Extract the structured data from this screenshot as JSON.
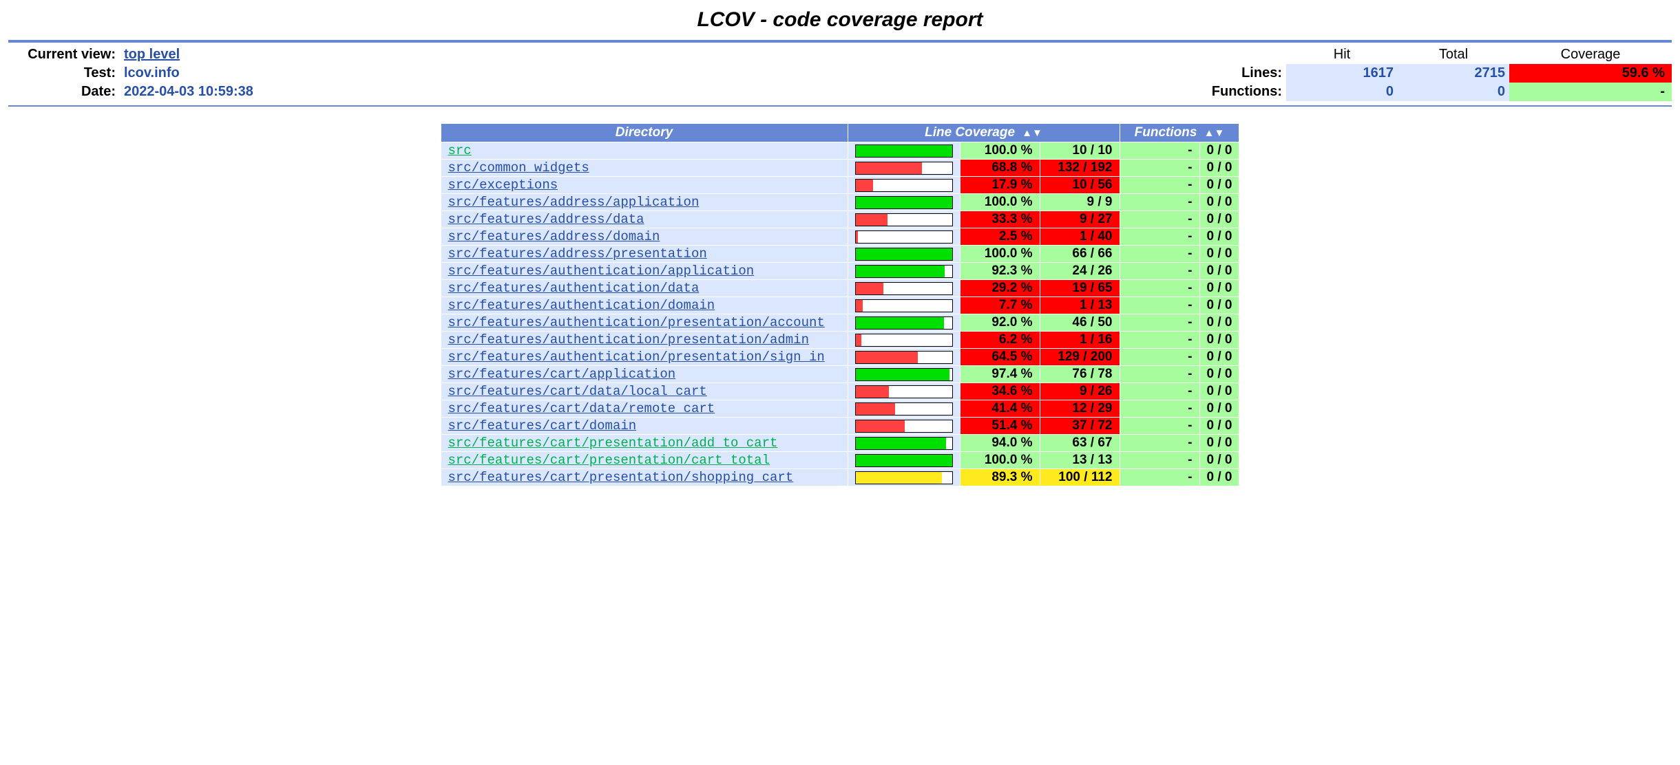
{
  "title": "LCOV - code coverage report",
  "summary": {
    "labels": {
      "current_view": "Current view:",
      "test": "Test:",
      "date": "Date:",
      "lines": "Lines:",
      "functions": "Functions:",
      "hit": "Hit",
      "total": "Total",
      "coverage": "Coverage"
    },
    "current_view": "top level",
    "test": "lcov.info",
    "date": "2022-04-03 10:59:38",
    "lines": {
      "hit": "1617",
      "total": "2715",
      "cov": "59.6 %",
      "level": "lo"
    },
    "functions": {
      "hit": "0",
      "total": "0",
      "cov": "-",
      "level": "hi"
    }
  },
  "table": {
    "headers": {
      "directory": "Directory",
      "line_coverage": "Line Coverage",
      "functions": "Functions",
      "sort_glyph": "◆"
    },
    "rows": [
      {
        "name": "src",
        "link": "green",
        "pct": 100.0,
        "pct_s": "100.0 %",
        "cnt": "10 / 10",
        "fpct": "-",
        "fcnt": "0 / 0"
      },
      {
        "name": "src/common_widgets",
        "link": "blue",
        "pct": 68.8,
        "pct_s": "68.8 %",
        "cnt": "132 / 192",
        "fpct": "-",
        "fcnt": "0 / 0"
      },
      {
        "name": "src/exceptions",
        "link": "blue",
        "pct": 17.9,
        "pct_s": "17.9 %",
        "cnt": "10 / 56",
        "fpct": "-",
        "fcnt": "0 / 0"
      },
      {
        "name": "src/features/address/application",
        "link": "blue",
        "pct": 100.0,
        "pct_s": "100.0 %",
        "cnt": "9 / 9",
        "fpct": "-",
        "fcnt": "0 / 0"
      },
      {
        "name": "src/features/address/data",
        "link": "blue",
        "pct": 33.3,
        "pct_s": "33.3 %",
        "cnt": "9 / 27",
        "fpct": "-",
        "fcnt": "0 / 0"
      },
      {
        "name": "src/features/address/domain",
        "link": "blue",
        "pct": 2.5,
        "pct_s": "2.5 %",
        "cnt": "1 / 40",
        "fpct": "-",
        "fcnt": "0 / 0"
      },
      {
        "name": "src/features/address/presentation",
        "link": "blue",
        "pct": 100.0,
        "pct_s": "100.0 %",
        "cnt": "66 / 66",
        "fpct": "-",
        "fcnt": "0 / 0"
      },
      {
        "name": "src/features/authentication/application",
        "link": "blue",
        "pct": 92.3,
        "pct_s": "92.3 %",
        "cnt": "24 / 26",
        "fpct": "-",
        "fcnt": "0 / 0"
      },
      {
        "name": "src/features/authentication/data",
        "link": "blue",
        "pct": 29.2,
        "pct_s": "29.2 %",
        "cnt": "19 / 65",
        "fpct": "-",
        "fcnt": "0 / 0"
      },
      {
        "name": "src/features/authentication/domain",
        "link": "blue",
        "pct": 7.7,
        "pct_s": "7.7 %",
        "cnt": "1 / 13",
        "fpct": "-",
        "fcnt": "0 / 0"
      },
      {
        "name": "src/features/authentication/presentation/account",
        "link": "blue",
        "pct": 92.0,
        "pct_s": "92.0 %",
        "cnt": "46 / 50",
        "fpct": "-",
        "fcnt": "0 / 0"
      },
      {
        "name": "src/features/authentication/presentation/admin",
        "link": "blue",
        "pct": 6.2,
        "pct_s": "6.2 %",
        "cnt": "1 / 16",
        "fpct": "-",
        "fcnt": "0 / 0"
      },
      {
        "name": "src/features/authentication/presentation/sign_in",
        "link": "blue",
        "pct": 64.5,
        "pct_s": "64.5 %",
        "cnt": "129 / 200",
        "fpct": "-",
        "fcnt": "0 / 0"
      },
      {
        "name": "src/features/cart/application",
        "link": "blue",
        "pct": 97.4,
        "pct_s": "97.4 %",
        "cnt": "76 / 78",
        "fpct": "-",
        "fcnt": "0 / 0"
      },
      {
        "name": "src/features/cart/data/local_cart",
        "link": "blue",
        "pct": 34.6,
        "pct_s": "34.6 %",
        "cnt": "9 / 26",
        "fpct": "-",
        "fcnt": "0 / 0"
      },
      {
        "name": "src/features/cart/data/remote_cart",
        "link": "blue",
        "pct": 41.4,
        "pct_s": "41.4 %",
        "cnt": "12 / 29",
        "fpct": "-",
        "fcnt": "0 / 0"
      },
      {
        "name": "src/features/cart/domain",
        "link": "blue",
        "pct": 51.4,
        "pct_s": "51.4 %",
        "cnt": "37 / 72",
        "fpct": "-",
        "fcnt": "0 / 0"
      },
      {
        "name": "src/features/cart/presentation/add_to_cart",
        "link": "green",
        "pct": 94.0,
        "pct_s": "94.0 %",
        "cnt": "63 / 67",
        "fpct": "-",
        "fcnt": "0 / 0"
      },
      {
        "name": "src/features/cart/presentation/cart_total",
        "link": "green",
        "pct": 100.0,
        "pct_s": "100.0 %",
        "cnt": "13 / 13",
        "fpct": "-",
        "fcnt": "0 / 0"
      },
      {
        "name": "src/features/cart/presentation/shopping_cart",
        "link": "blue",
        "pct": 89.3,
        "pct_s": "89.3 %",
        "cnt": "100 / 112",
        "fpct": "-",
        "fcnt": "0 / 0"
      }
    ]
  }
}
